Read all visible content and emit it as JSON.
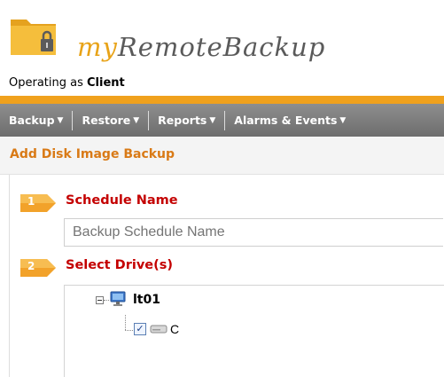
{
  "app": {
    "brand_prefix": "my",
    "brand_suffix": "RemoteBackup",
    "operating_prefix": "Operating as",
    "operating_user": "Client"
  },
  "menu": {
    "items": [
      {
        "label": "Backup"
      },
      {
        "label": "Restore"
      },
      {
        "label": "Reports"
      },
      {
        "label": "Alarms & Events"
      }
    ]
  },
  "page": {
    "title": "Add Disk Image Backup"
  },
  "steps": [
    {
      "number": "1",
      "label": "Schedule Name"
    },
    {
      "number": "2",
      "label": "Select Drive(s)"
    }
  ],
  "schedule_name_input": {
    "value": "",
    "placeholder": "Backup Schedule Name"
  },
  "drive_tree": {
    "computer": "lt01",
    "drives": [
      {
        "label": "C",
        "checked": true
      }
    ]
  },
  "colors": {
    "accent_orange": "#f0a11d",
    "step_red": "#c40000",
    "menu_gray": "#7a7a7a"
  }
}
